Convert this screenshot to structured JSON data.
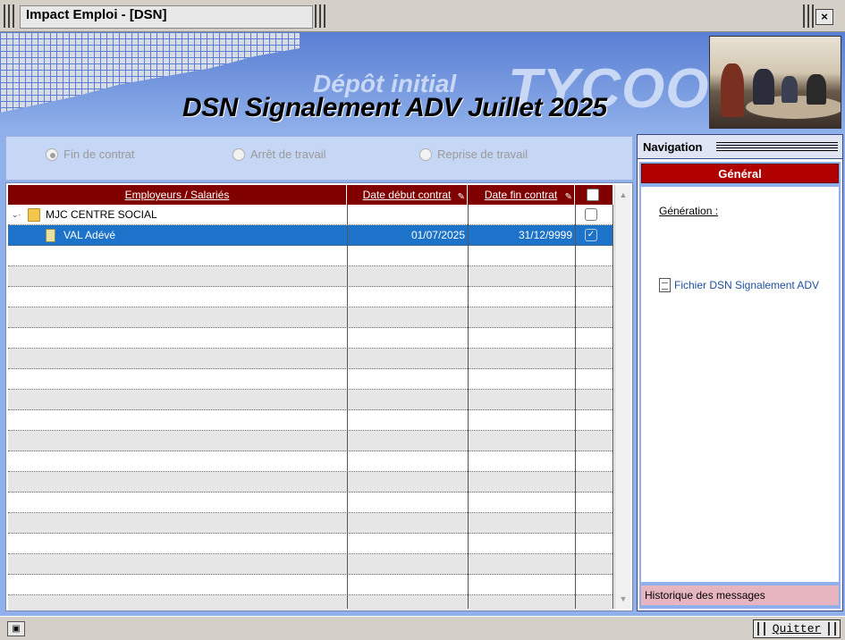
{
  "window": {
    "title": "Impact Emploi - [DSN]",
    "close_glyph": "×"
  },
  "banner": {
    "brand": "TYCOON",
    "subtitle": "Dépôt initial",
    "title": "DSN Signalement ADV Juillet 2025"
  },
  "radios": [
    {
      "label": "Fin de contrat",
      "selected": true
    },
    {
      "label": "Arrêt de travail",
      "selected": false
    },
    {
      "label": "Reprise de travail",
      "selected": false
    }
  ],
  "grid": {
    "columns": [
      "Employeurs / Salariés",
      "Date début contrat",
      "Date fin contrat"
    ],
    "rows": [
      {
        "name": "MJC CENTRE SOCIAL",
        "start": "",
        "end": "",
        "checked": false,
        "level": 0,
        "selected": false
      },
      {
        "name": "VAL  Adévé",
        "start": "01/07/2025",
        "end": "31/12/9999",
        "checked": true,
        "level": 1,
        "selected": true
      }
    ]
  },
  "navigation": {
    "title": "Navigation",
    "section": "Général",
    "generation_label": "Génération :",
    "link": "Fichier DSN Signalement ADV",
    "history": "Historique des messages"
  },
  "statusbar": {
    "quit_label": "Quitter"
  }
}
